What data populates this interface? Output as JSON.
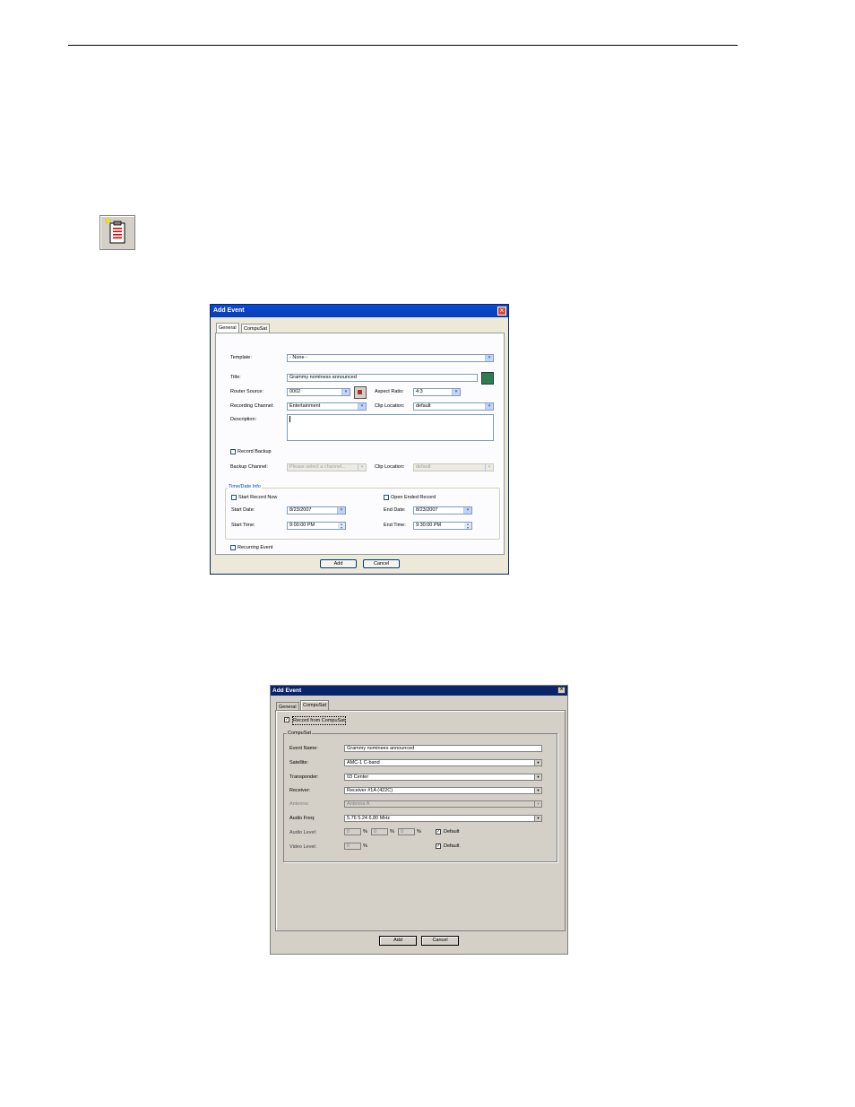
{
  "icon": "record-event-icon",
  "dialog1": {
    "title": "Add Event",
    "tabs": [
      "General",
      "CompuSat"
    ],
    "template_label": "Template:",
    "template_value": "- None -",
    "title_label": "Title:",
    "title_value": "Grammy nominess announced",
    "router_source_label": "Router Source:",
    "router_source_value": "0002",
    "aspect_ratio_label": "Aspect Ratio:",
    "aspect_ratio_value": "4:3",
    "recording_channel_label": "Recording Channel:",
    "recording_channel_value": "Entertainment",
    "clip_location_label": "Clip Location:",
    "clip_location_value": "default",
    "description_label": "Description:",
    "description_value": "",
    "record_backup_label": "Record Backup",
    "backup_channel_label": "Backup Channel:",
    "backup_channel_placeholder": "Please select a channel...",
    "backup_clip_location_label": "Clip Location:",
    "backup_clip_location_value": "default",
    "time_group_label": "Time/Date Info",
    "start_record_now_label": "Start Record Now",
    "open_ended_label": "Open Ended Record",
    "start_date_label": "Start Date:",
    "start_date_value": "8/23/2007",
    "end_date_label": "End Date:",
    "end_date_value": "8/23/2007",
    "start_time_label": "Start Time:",
    "start_time_value": "9:00:00 PM",
    "end_time_label": "End Time:",
    "end_time_value": "9:30:00 PM",
    "recurring_label": "Recurring Event",
    "add_label": "Add",
    "cancel_label": "Cancel"
  },
  "dialog2": {
    "title": "Add Event",
    "tabs": [
      "General",
      "CompuSat"
    ],
    "record_from_compusat_label": "Record from CompuSat",
    "group_label": "CompuSat",
    "event_name_label": "Event Name:",
    "event_name_value": "Grammy nominees announced",
    "satellite_label": "Satellite:",
    "satellite_value": "AMC-1  C-band",
    "transponder_label": "Transponder:",
    "transponder_value": "03 Center",
    "receiver_label": "Receiver:",
    "receiver_value": "Receiver #1A (422C)",
    "antenna_label": "Antenna:",
    "antenna_value": "Antenna A",
    "audio_freq_label": "Audio Freq:",
    "audio_freq_value": "5.76 5.24 6.80 MHz",
    "audio_level_label": "Audio Level:",
    "audio_level_values": [
      "0",
      "0",
      "0"
    ],
    "percent": "%",
    "video_level_label": "Video Level:",
    "video_level_value": "0",
    "default_label": "Default",
    "add_label": "Add",
    "cancel_label": "Cancel"
  }
}
